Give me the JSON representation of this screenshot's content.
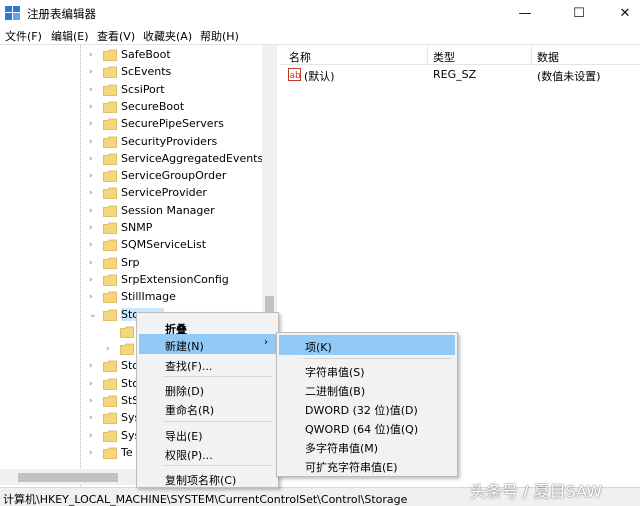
{
  "window": {
    "title": "注册表编辑器",
    "minimize": "—",
    "maximize": "☐",
    "close": "✕"
  },
  "menu": [
    "文件(F)",
    "编辑(E)",
    "查看(V)",
    "收藏夹(A)",
    "帮助(H)"
  ],
  "tree": {
    "items": [
      "SafeBoot",
      "ScEvents",
      "ScsiPort",
      "SecureBoot",
      "SecurePipeServers",
      "SecurityProviders",
      "ServiceAggregatedEvents",
      "ServiceGroupOrder",
      "ServiceProvider",
      "Session Manager",
      "SNMP",
      "SQMServiceList",
      "Srp",
      "SrpExtensionConfig",
      "StillImage",
      "Storage"
    ],
    "partial_items": [
      "Sto",
      "Sto",
      "StS",
      "Sys",
      "Sys",
      "Te"
    ]
  },
  "list": {
    "columns": [
      "名称",
      "类型",
      "数据"
    ],
    "rows": [
      {
        "name": "(默认)",
        "type": "REG_SZ",
        "data": "(数值未设置)"
      }
    ]
  },
  "context_menu": {
    "items": [
      "折叠",
      "新建(N)",
      "查找(F)...",
      "删除(D)",
      "重命名(R)",
      "导出(E)",
      "权限(P)...",
      "复制项名称(C)"
    ]
  },
  "submenu": {
    "items": [
      "项(K)",
      "字符串值(S)",
      "二进制值(B)",
      "DWORD (32 位)值(D)",
      "QWORD (64 位)值(Q)",
      "多字符串值(M)",
      "可扩充字符串值(E)"
    ]
  },
  "status": {
    "path": "计算机\\HKEY_LOCAL_MACHINE\\SYSTEM\\CurrentControlSet\\Control\\Storage"
  },
  "watermark": "头条号 / 夏目SAW",
  "colors": {
    "highlight": "#91c9f7",
    "folder": "#f5d67b",
    "menu_bg": "#f2f2f2"
  }
}
